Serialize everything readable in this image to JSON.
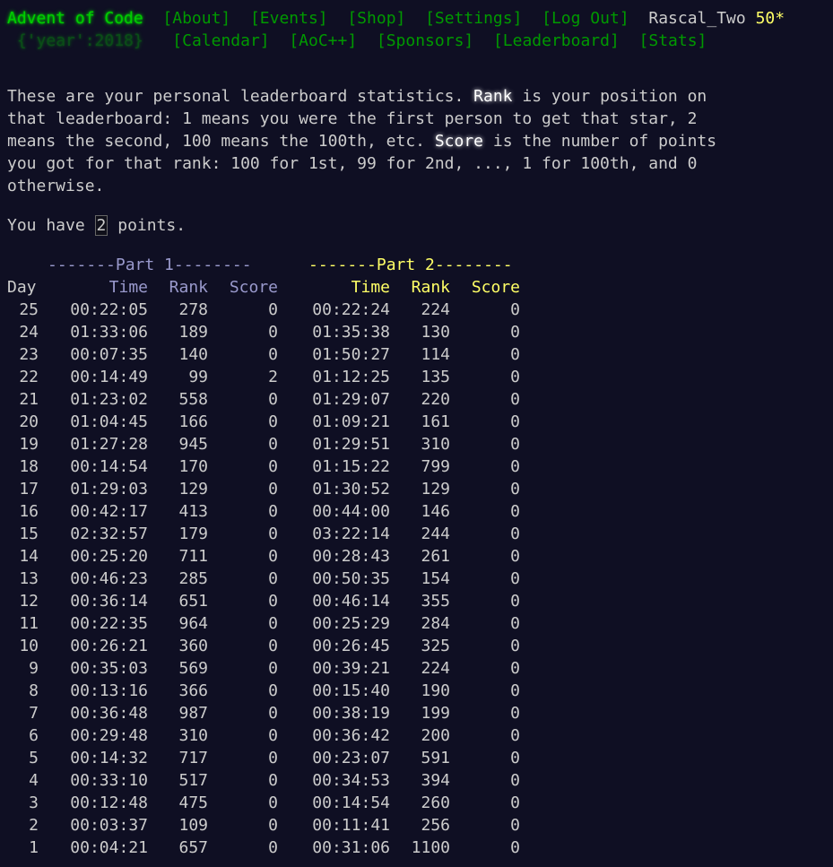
{
  "header": {
    "logo": "Advent of Code",
    "nav_top": [
      "[About]",
      "[Events]",
      "[Shop]",
      "[Settings]",
      "[Log Out]"
    ],
    "user": "Rascal_Two",
    "stars": "50*",
    "year_prefix": "{'year':",
    "year_value": "2018",
    "year_suffix": "}",
    "nav_bottom": [
      "[Calendar]",
      "[AoC++]",
      "[Sponsors]",
      "[Leaderboard]",
      "[Stats]"
    ]
  },
  "intro": {
    "line1_a": "These are your personal leaderboard statistics. ",
    "rank_word": "Rank",
    "line1_b": " is your position on",
    "line2": "that leaderboard: 1 means you were the first person to get that star, 2",
    "line3_a": "means the second, 100 means the 100th, etc. ",
    "score_word": "Score",
    "line3_b": " is the number of points",
    "line4": "you got for that rank: 100 for 1st, 99 for 2nd, ..., 1 for 100th, and 0",
    "line5": "otherwise."
  },
  "points": {
    "prefix": "You have ",
    "value": "2",
    "suffix": " points."
  },
  "table": {
    "part1_label": "-------Part 1--------",
    "part2_label": "-------Part 2--------",
    "headers": {
      "day": "Day",
      "time": "Time",
      "rank": "Rank",
      "score": "Score"
    },
    "rows": [
      {
        "day": "25",
        "t1": "00:22:05",
        "r1": "278",
        "s1": "0",
        "t2": "00:22:24",
        "r2": "224",
        "s2": "0"
      },
      {
        "day": "24",
        "t1": "01:33:06",
        "r1": "189",
        "s1": "0",
        "t2": "01:35:38",
        "r2": "130",
        "s2": "0"
      },
      {
        "day": "23",
        "t1": "00:07:35",
        "r1": "140",
        "s1": "0",
        "t2": "01:50:27",
        "r2": "114",
        "s2": "0"
      },
      {
        "day": "22",
        "t1": "00:14:49",
        "r1": "99",
        "s1": "2",
        "t2": "01:12:25",
        "r2": "135",
        "s2": "0"
      },
      {
        "day": "21",
        "t1": "01:23:02",
        "r1": "558",
        "s1": "0",
        "t2": "01:29:07",
        "r2": "220",
        "s2": "0"
      },
      {
        "day": "20",
        "t1": "01:04:45",
        "r1": "166",
        "s1": "0",
        "t2": "01:09:21",
        "r2": "161",
        "s2": "0"
      },
      {
        "day": "19",
        "t1": "01:27:28",
        "r1": "945",
        "s1": "0",
        "t2": "01:29:51",
        "r2": "310",
        "s2": "0"
      },
      {
        "day": "18",
        "t1": "00:14:54",
        "r1": "170",
        "s1": "0",
        "t2": "01:15:22",
        "r2": "799",
        "s2": "0"
      },
      {
        "day": "17",
        "t1": "01:29:03",
        "r1": "129",
        "s1": "0",
        "t2": "01:30:52",
        "r2": "129",
        "s2": "0"
      },
      {
        "day": "16",
        "t1": "00:42:17",
        "r1": "413",
        "s1": "0",
        "t2": "00:44:00",
        "r2": "146",
        "s2": "0"
      },
      {
        "day": "15",
        "t1": "02:32:57",
        "r1": "179",
        "s1": "0",
        "t2": "03:22:14",
        "r2": "244",
        "s2": "0"
      },
      {
        "day": "14",
        "t1": "00:25:20",
        "r1": "711",
        "s1": "0",
        "t2": "00:28:43",
        "r2": "261",
        "s2": "0"
      },
      {
        "day": "13",
        "t1": "00:46:23",
        "r1": "285",
        "s1": "0",
        "t2": "00:50:35",
        "r2": "154",
        "s2": "0"
      },
      {
        "day": "12",
        "t1": "00:36:14",
        "r1": "651",
        "s1": "0",
        "t2": "00:46:14",
        "r2": "355",
        "s2": "0"
      },
      {
        "day": "11",
        "t1": "00:22:35",
        "r1": "964",
        "s1": "0",
        "t2": "00:25:29",
        "r2": "284",
        "s2": "0"
      },
      {
        "day": "10",
        "t1": "00:26:21",
        "r1": "360",
        "s1": "0",
        "t2": "00:26:45",
        "r2": "325",
        "s2": "0"
      },
      {
        "day": "9",
        "t1": "00:35:03",
        "r1": "569",
        "s1": "0",
        "t2": "00:39:21",
        "r2": "224",
        "s2": "0"
      },
      {
        "day": "8",
        "t1": "00:13:16",
        "r1": "366",
        "s1": "0",
        "t2": "00:15:40",
        "r2": "190",
        "s2": "0"
      },
      {
        "day": "7",
        "t1": "00:36:48",
        "r1": "987",
        "s1": "0",
        "t2": "00:38:19",
        "r2": "199",
        "s2": "0"
      },
      {
        "day": "6",
        "t1": "00:29:48",
        "r1": "310",
        "s1": "0",
        "t2": "00:36:42",
        "r2": "200",
        "s2": "0"
      },
      {
        "day": "5",
        "t1": "00:14:32",
        "r1": "717",
        "s1": "0",
        "t2": "00:23:07",
        "r2": "591",
        "s2": "0"
      },
      {
        "day": "4",
        "t1": "00:33:10",
        "r1": "517",
        "s1": "0",
        "t2": "00:34:53",
        "r2": "394",
        "s2": "0"
      },
      {
        "day": "3",
        "t1": "00:12:48",
        "r1": "475",
        "s1": "0",
        "t2": "00:14:54",
        "r2": "260",
        "s2": "0"
      },
      {
        "day": "2",
        "t1": "00:03:37",
        "r1": "109",
        "s1": "0",
        "t2": "00:11:41",
        "r2": "256",
        "s2": "0"
      },
      {
        "day": "1",
        "t1": "00:04:21",
        "r1": "657",
        "s1": "0",
        "t2": "00:31:06",
        "r2": "1100",
        "s2": "0"
      }
    ]
  },
  "colors": {
    "background": "#0f0f23",
    "text": "#cccccc",
    "logo_green": "#00cc00",
    "link_green": "#009900",
    "part1": "#9999cc",
    "part2": "#ffff66"
  }
}
